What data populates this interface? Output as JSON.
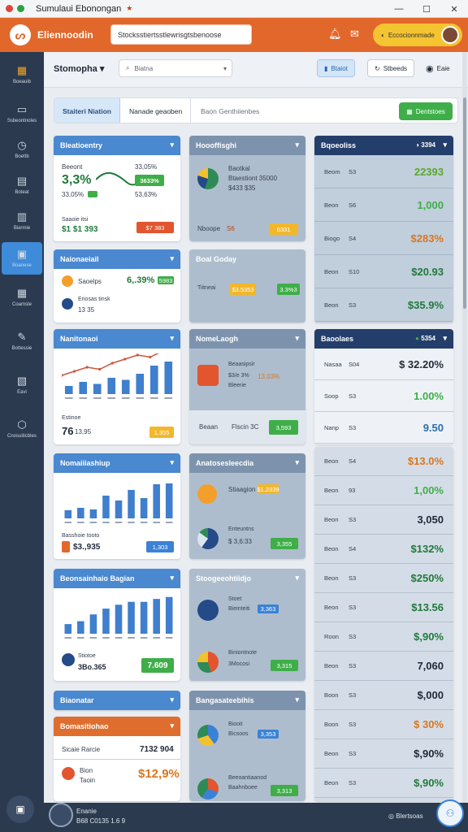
{
  "window": {
    "title": "Sumulaui Ebonongan",
    "controls": [
      "—",
      "☐",
      "✕"
    ]
  },
  "app": {
    "name": "Eliennoodin",
    "search_value": "Stocksstiertsstlewrisgtsbenoose",
    "user_pill": "Eccocionnmade"
  },
  "sidebar": {
    "items": [
      {
        "label": "Boeauib",
        "icon": "dashboard-icon"
      },
      {
        "label": "Ssbeontnoles",
        "icon": "monitor-icon"
      },
      {
        "label": "Boettb",
        "icon": "clock-icon"
      },
      {
        "label": "Boteat",
        "icon": "table-icon"
      },
      {
        "label": "Biarmie",
        "icon": "chart-icon"
      },
      {
        "label": "Boanese",
        "icon": "screen-icon"
      },
      {
        "label": "Coamste",
        "icon": "calendar-icon"
      },
      {
        "label": "Bottessie",
        "icon": "pen-icon"
      },
      {
        "label": "Eavi",
        "icon": "image-icon"
      },
      {
        "label": "Cnosuiticbtes",
        "icon": "cube-icon"
      }
    ]
  },
  "toolbar": {
    "workspace": "Stomopha",
    "select_placeholder": "Biatna",
    "btn1": "Btaiot",
    "btn2": "Stbeeds",
    "btn3": "Eaie"
  },
  "filters": {
    "tab1": "Staiteri Niation",
    "tab2": "Nanade geaoben",
    "tab3": "Baon Genthiienbes",
    "action": "Dentstoes"
  },
  "col1": {
    "c1": {
      "title": "Bleatioentry",
      "l1": "Beeont",
      "v1": "3,3%",
      "p1": "33,05%",
      "b1": "3633%",
      "l2": "33,05%",
      "l3": "53,63%",
      "l4": "Saaoie itsi",
      "v2": "$1 $1 393",
      "b2": "$7 383"
    },
    "c2": {
      "title": "Naionaeiail",
      "l1": "Saoelps",
      "v1": "6,.39%",
      "b1": "5983",
      "l2": "Eriosas tinsk",
      "l3": "13 35"
    },
    "c3": {
      "title": "Nanitonaoi",
      "l1": "Estinoe",
      "v1": "76",
      "v2": "13,95",
      "b1": "1.355"
    },
    "c4": {
      "title": "Nomaiiiashiup",
      "l1": "Basshoie tooto",
      "v1": "$3.,935",
      "b1": "1,303"
    },
    "c5": {
      "title": "Beonsainhaio Bagian",
      "l1": "Stiotoe",
      "v1": "3Bo.365",
      "b1": "7.609"
    },
    "c6": {
      "title": "Biaonatar"
    },
    "c7": {
      "title": "Bomasitiohao",
      "l1": "Sicaie Rarcie",
      "v1": "7132 904",
      "l2": "Bion",
      "l3": "Taoin",
      "v2": "$12,9%"
    }
  },
  "col2": {
    "c1": {
      "title": "Hoooffisghi",
      "l1": "Baotkal",
      "l2": "Btaestiont 35000",
      "l3": "$433 $35",
      "l4": "Nboope",
      "v1": "S6",
      "b1": "6331"
    },
    "c2": {
      "title": "Boal Goday",
      "l1": "Tiitneai",
      "b1": "$3.5353",
      "b2": "3.3%3"
    },
    "c3": {
      "title": "NomeLaogh",
      "l1": "Beaasipsir",
      "l2": "$3/e 3%",
      "l3": "Bleerie",
      "b0": "13,03%",
      "l4": "Beaan",
      "l5": "Flscin 3C",
      "b1": "3,593"
    },
    "c4": {
      "title": "Anatosesleecdia",
      "l1": "Stiaagion",
      "b1": "$1.2339",
      "l2": "Enteuntns",
      "l3": "$ 3,6:33",
      "b2": "3,355"
    },
    "c5": {
      "title": "Stoogeeohtiidjo",
      "l1": "Stoet",
      "l2": "Bieinteiti",
      "b1": "3,363",
      "l3": "Biniontnote",
      "l4": "3Mocosi",
      "b2": "3,315"
    },
    "c6": {
      "title": "Bangasateebihis",
      "l1": "Biooit",
      "l2": "Bicsoos",
      "b1": "3,353",
      "l3": "Beeoantiaanod",
      "l4": "Baahnboee",
      "b2": "3,313"
    }
  },
  "col3": {
    "h1": {
      "title": "Bqoeoliss",
      "badge": "3394"
    },
    "rows1": [
      {
        "name": "Beom",
        "code": "S3",
        "value": "22393"
      },
      {
        "name": "Beon",
        "code": "S6",
        "value": "1,000"
      },
      {
        "name": "Biogo",
        "code": "S4",
        "value": "$283%"
      },
      {
        "name": "Beon",
        "code": "S10",
        "value": "$20.93"
      },
      {
        "name": "Beon",
        "code": "S3",
        "value": "$35.9%"
      }
    ],
    "h2": {
      "title": "Baoolaes",
      "badge": "5354"
    },
    "rows2": [
      {
        "name": "Nasaa",
        "code": "S04",
        "value": "$ 32.20%"
      },
      {
        "name": "Soop",
        "code": "S3",
        "value": "1.00%"
      },
      {
        "name": "Nanp",
        "code": "S3",
        "value": "9.50"
      },
      {
        "name": "Beon",
        "code": "S4",
        "value": "$13.0%"
      },
      {
        "name": "Beon",
        "code": "93",
        "value": "1,00%"
      },
      {
        "name": "Beon",
        "code": "S3",
        "value": "3,050"
      },
      {
        "name": "Beon",
        "code": "S4",
        "value": "$132%"
      },
      {
        "name": "Beon",
        "code": "S3",
        "value": "$250%"
      },
      {
        "name": "Beon",
        "code": "S3",
        "value": "$13.56"
      },
      {
        "name": "Roon",
        "code": "S3",
        "value": "$,90%"
      },
      {
        "name": "Beon",
        "code": "S3",
        "value": "7,060"
      },
      {
        "name": "Boon",
        "code": "S3",
        "value": "$,000"
      },
      {
        "name": "Boon",
        "code": "S3",
        "value": "$ 30%"
      },
      {
        "name": "Beon",
        "code": "S3",
        "value": "$,90%"
      },
      {
        "name": "Beon",
        "code": "S3",
        "value": "$,90%"
      }
    ]
  },
  "bottom": {
    "left": "Enanie",
    "left2": "B68 C0135 1.6 9",
    "right": "Blertsoas"
  },
  "chart_data": [
    {
      "type": "line",
      "series": [
        {
          "values": [
            3,
            4,
            5,
            4.5,
            6,
            7,
            8,
            7.5,
            9,
            10
          ]
        }
      ]
    },
    {
      "type": "bar",
      "values": [
        2,
        3,
        2.5,
        4,
        3.5,
        5,
        7,
        8
      ]
    },
    {
      "type": "bar",
      "values": [
        1,
        1.3,
        1.1,
        2.8,
        2.2,
        3.5,
        2.5,
        4.2,
        4.3
      ]
    },
    {
      "type": "bar",
      "values": [
        1,
        1.3,
        2,
        2.6,
        3,
        3.3,
        3.3,
        3.6,
        3.8
      ]
    }
  ]
}
